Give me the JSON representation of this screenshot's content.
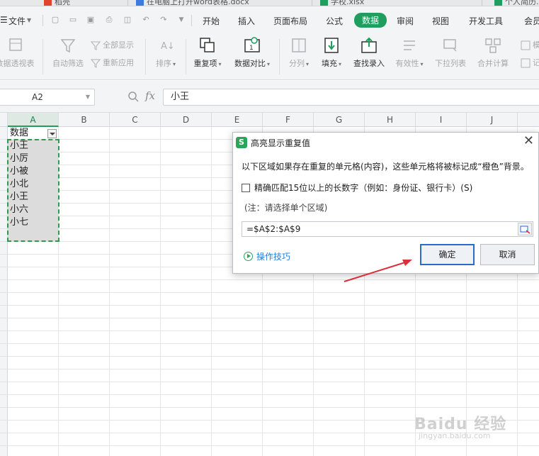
{
  "tabstrip": {
    "items": [
      "稻壳",
      "在电脑上打开word表格.docx",
      "学校.xlsx",
      "个人简历.xlsx"
    ]
  },
  "menubar": {
    "file_label": "文件",
    "tabs": [
      "开始",
      "插入",
      "页面布局",
      "公式",
      "数据",
      "审阅",
      "视图",
      "开发工具",
      "会员"
    ],
    "active_tab": "数据"
  },
  "ribbon": {
    "pivot": "数据透视表",
    "autofilter": "自动筛选",
    "show_all": "全部显示",
    "reapply": "重新应用",
    "sort": "排序",
    "duplicates": "重复项",
    "compare": "数据对比",
    "split": "分列",
    "fill": "填充",
    "lookup": "查找录入",
    "validity": "有效性",
    "dropdown": "下拉列表",
    "consolidate": "合并计算",
    "simulate": "模",
    "record": "记"
  },
  "formula_bar": {
    "cell_ref": "A2",
    "fx": "fx",
    "value": "小王"
  },
  "columns": [
    "A",
    "B",
    "C",
    "D",
    "E",
    "F",
    "G",
    "H",
    "I",
    "J"
  ],
  "selected_column": "A",
  "sheet": {
    "header": "数据",
    "values": [
      "小王",
      "小厉",
      "小被",
      "小北",
      "小王",
      "小六",
      "小七",
      ""
    ]
  },
  "dialog": {
    "title": "高亮显示重复值",
    "description": "以下区域如果存在重复的单元格(内容)，这些单元格将被标记成“橙色”背景。",
    "checkbox_label": "精确匹配15位以上的长数字（例如：身份证、银行卡）(S)",
    "checkbox_checked": false,
    "note": "(注：请选择单个区域)",
    "range": "=$A$2:$A$9",
    "tips_link": "操作技巧",
    "ok_label": "确定",
    "cancel_label": "取消"
  },
  "watermark": {
    "text": "Baidu 经验",
    "sub": "jingyan.baidu.com"
  },
  "colors": {
    "accent": "#1f9e5d",
    "selection_border": "#2f9a4e",
    "ok_border": "#2a6cc9",
    "arrow": "#d9303a",
    "dup_fill": "#dcdcdc"
  }
}
